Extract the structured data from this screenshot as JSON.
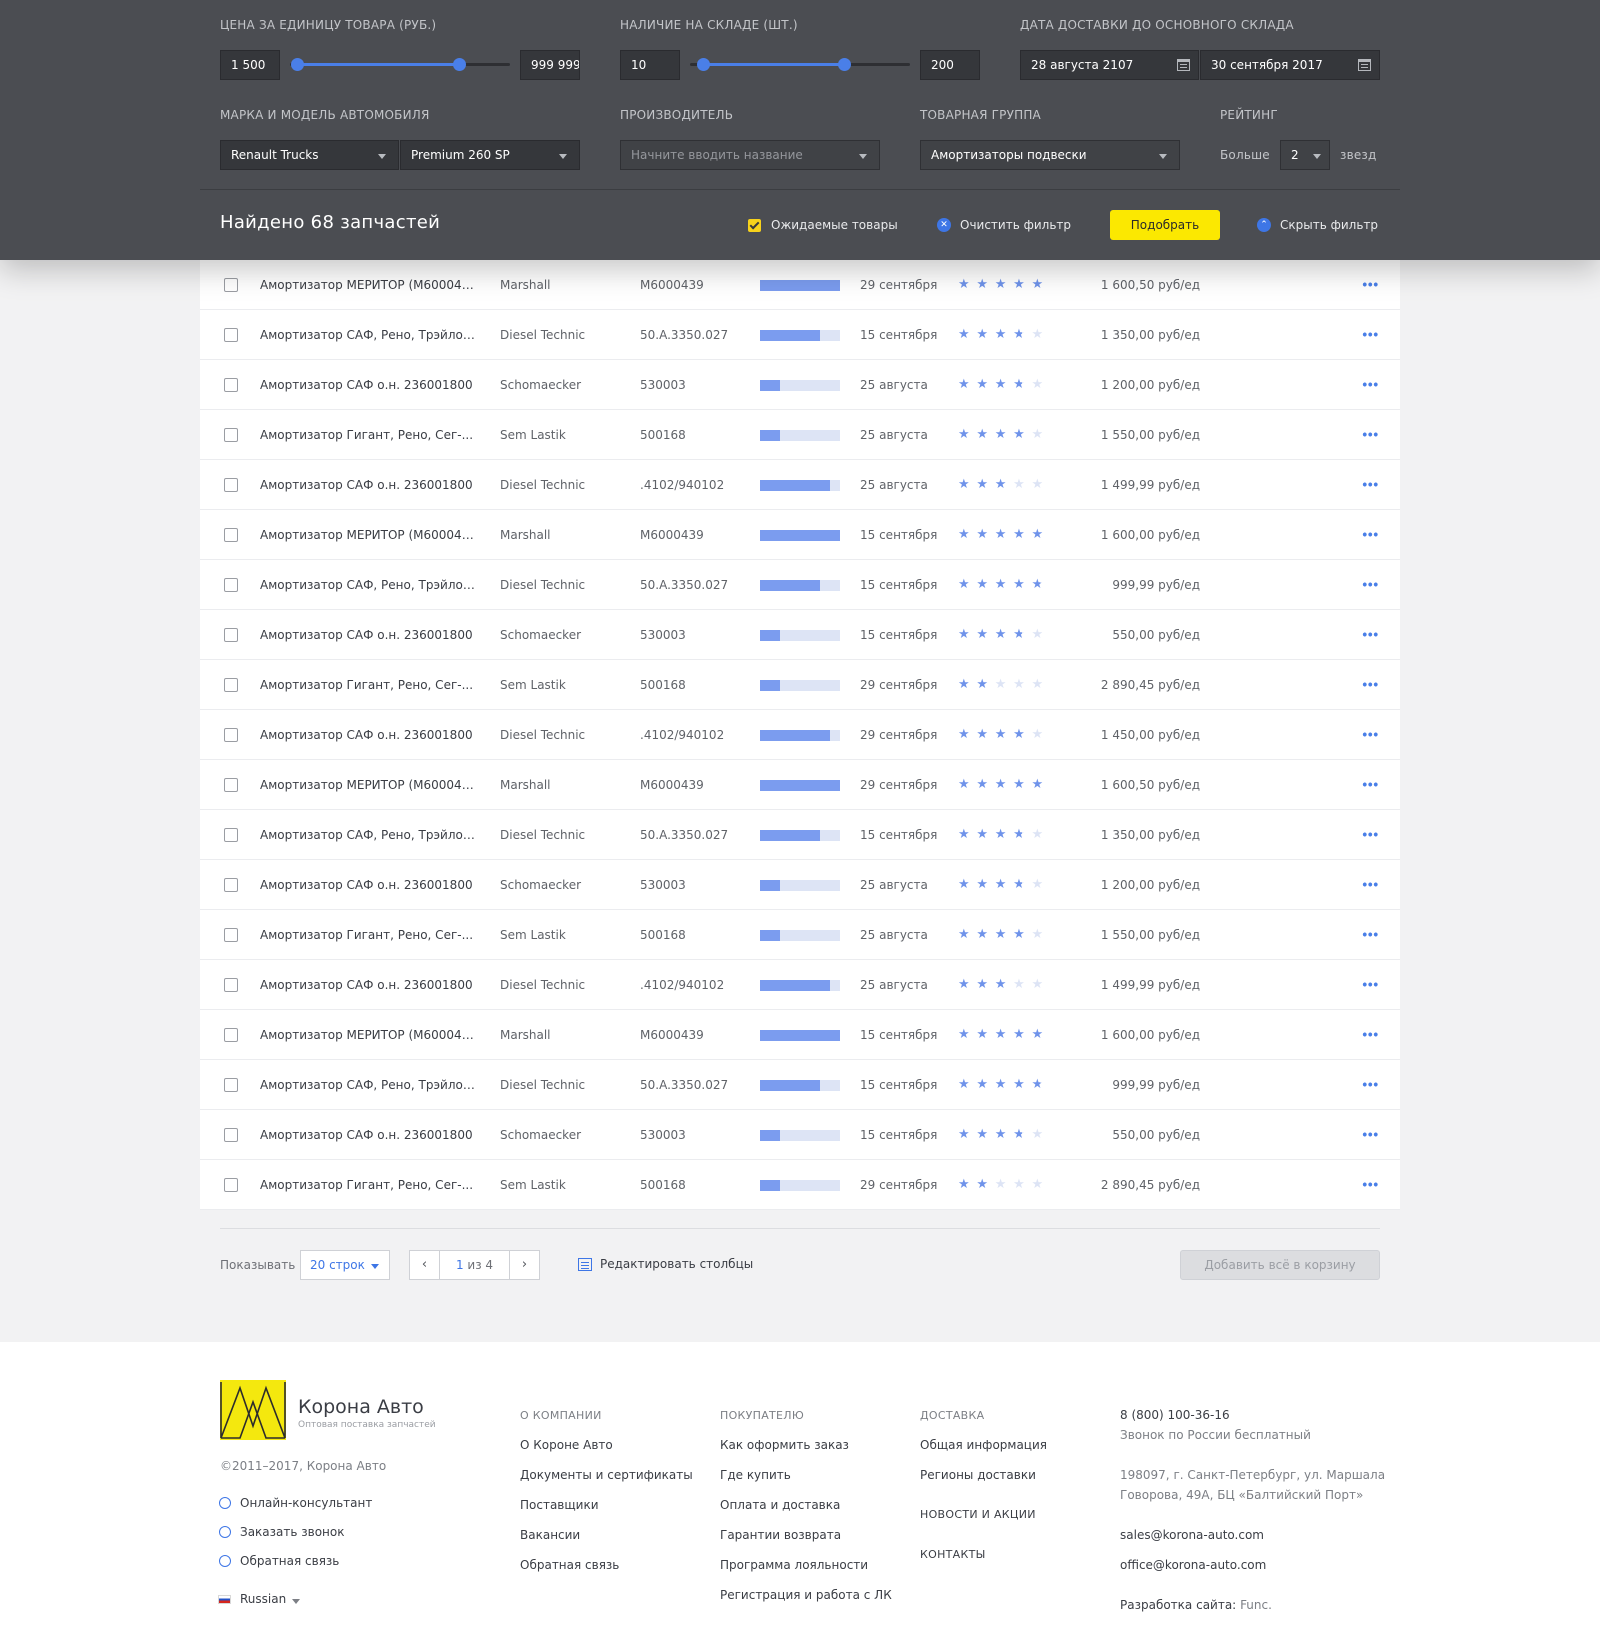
{
  "filters": {
    "price": {
      "label": "Цена за единицу товара (руб.)",
      "min": "1 500",
      "max": "999 999",
      "range_low": 0.03,
      "range_high": 0.77
    },
    "stock": {
      "label": "Наличие на складе (шт.)",
      "min": "10",
      "max": "200",
      "range_low": 0.06,
      "range_high": 0.7
    },
    "delivery_date": {
      "label": "Дата доставки до основного склада",
      "from": "28 августа 2107",
      "to": "30 сентября 2017"
    },
    "car_model": {
      "label": "Марка и модель автомобиля",
      "make": "Renault Trucks",
      "model": "Premium 260 SP"
    },
    "manufacturer": {
      "label": "Производитель",
      "placeholder": "Начните вводить название"
    },
    "product_group": {
      "label": "Товарная группа",
      "value": "Амортизаторы подвески"
    },
    "rating": {
      "label": "Рейтинг",
      "prefix": "Больше",
      "value": "2",
      "suffix": "звезд"
    }
  },
  "summary": {
    "found": "Найдено 68 запчастей",
    "expected_goods": "Ожидаемые товары",
    "clear_filter": "Очистить фильтр",
    "pick": "Подобрать",
    "hide_filter": "Скрыть фильтр"
  },
  "colors": {
    "accent": "#3e76e6",
    "stock_bar": "#7b9cef",
    "button_yellow": "#fbe801",
    "panel": "#4b4d52"
  },
  "rows": [
    {
      "name": "Амортизатор МЕРИТОР (M6000439)",
      "brand": "Marshall",
      "code": "M6000439",
      "stock": 1.0,
      "date": "29 сентября",
      "rating": 5,
      "price": "1 600,50 руб/ед"
    },
    {
      "name": "Амортизатор САФ, Рено, Трэйлор...",
      "brand": "Diesel Technic",
      "code": "50.A.3350.027",
      "stock": 0.75,
      "date": "15 сентября",
      "rating": 3.5,
      "price": "1 350,00 руб/ед"
    },
    {
      "name": "Амортизатор САФ о.н. 236001800",
      "brand": "Schomaecker",
      "code": "530003",
      "stock": 0.25,
      "date": "25 августа",
      "rating": 3.5,
      "price": "1 200,00 руб/ед"
    },
    {
      "name": "Амортизатор Гигант, Рено, Сег-...",
      "brand": "Sem Lastik",
      "code": "500168",
      "stock": 0.25,
      "date": "25 августа",
      "rating": 4,
      "price": "1 550,00 руб/ед"
    },
    {
      "name": "Амортизатор САФ о.н. 236001800",
      "brand": "Diesel Technic",
      "code": ".4102/940102",
      "stock": 0.88,
      "date": "25 августа",
      "rating": 3,
      "price": "1 499,99 руб/ед"
    },
    {
      "name": "Амортизатор МЕРИТОР (M6000439)",
      "brand": "Marshall",
      "code": "M6000439",
      "stock": 1.0,
      "date": "15 сентября",
      "rating": 5,
      "price": "1 600,00 руб/ед"
    },
    {
      "name": "Амортизатор САФ, Рено, Трэйлор...",
      "brand": "Diesel Technic",
      "code": "50.A.3350.027",
      "stock": 0.75,
      "date": "15 сентября",
      "rating": 4.5,
      "price": "999,99 руб/ед"
    },
    {
      "name": "Амортизатор САФ о.н. 236001800",
      "brand": "Schomaecker",
      "code": "530003",
      "stock": 0.25,
      "date": "15 сентября",
      "rating": 3.5,
      "price": "550,00 руб/ед"
    },
    {
      "name": "Амортизатор Гигант, Рено, Сег-...",
      "brand": "Sem Lastik",
      "code": "500168",
      "stock": 0.25,
      "date": "29 сентября",
      "rating": 2,
      "price": "2 890,45 руб/ед"
    },
    {
      "name": "Амортизатор САФ о.н. 236001800",
      "brand": "Diesel Technic",
      "code": ".4102/940102",
      "stock": 0.88,
      "date": "29 сентября",
      "rating": 4,
      "price": "1 450,00 руб/ед"
    },
    {
      "name": "Амортизатор МЕРИТОР (M6000439)",
      "brand": "Marshall",
      "code": "M6000439",
      "stock": 1.0,
      "date": "29 сентября",
      "rating": 5,
      "price": "1 600,50 руб/ед"
    },
    {
      "name": "Амортизатор САФ, Рено, Трэйлор...",
      "brand": "Diesel Technic",
      "code": "50.A.3350.027",
      "stock": 0.75,
      "date": "15 сентября",
      "rating": 3.5,
      "price": "1 350,00 руб/ед"
    },
    {
      "name": "Амортизатор САФ о.н. 236001800",
      "brand": "Schomaecker",
      "code": "530003",
      "stock": 0.25,
      "date": "25 августа",
      "rating": 3.5,
      "price": "1 200,00 руб/ед"
    },
    {
      "name": "Амортизатор Гигант, Рено, Сег-...",
      "brand": "Sem Lastik",
      "code": "500168",
      "stock": 0.25,
      "date": "25 августа",
      "rating": 4,
      "price": "1 550,00 руб/ед"
    },
    {
      "name": "Амортизатор САФ о.н. 236001800",
      "brand": "Diesel Technic",
      "code": ".4102/940102",
      "stock": 0.88,
      "date": "25 августа",
      "rating": 3,
      "price": "1 499,99 руб/ед"
    },
    {
      "name": "Амортизатор МЕРИТОР (M6000439)",
      "brand": "Marshall",
      "code": "M6000439",
      "stock": 1.0,
      "date": "15 сентября",
      "rating": 5,
      "price": "1 600,00 руб/ед"
    },
    {
      "name": "Амортизатор САФ, Рено, Трэйлор...",
      "brand": "Diesel Technic",
      "code": "50.A.3350.027",
      "stock": 0.75,
      "date": "15 сентября",
      "rating": 4.5,
      "price": "999,99 руб/ед"
    },
    {
      "name": "Амортизатор САФ о.н. 236001800",
      "brand": "Schomaecker",
      "code": "530003",
      "stock": 0.25,
      "date": "15 сентября",
      "rating": 3.5,
      "price": "550,00 руб/ед"
    },
    {
      "name": "Амортизатор Гигант, Рено, Сег-...",
      "brand": "Sem Lastik",
      "code": "500168",
      "stock": 0.25,
      "date": "29 сентября",
      "rating": 2,
      "price": "2 890,45 руб/ед"
    }
  ],
  "table_footer": {
    "show_label": "Показывать",
    "rows_per_page": "20 строк",
    "page_current": "1",
    "page_rest": "из 4",
    "edit_columns": "Редактировать столбцы",
    "add_all": "Добавить всё в корзину"
  },
  "footer": {
    "brand_name": "Корона Авто",
    "brand_tagline": "Оптовая поставка запчастей",
    "copyright": "©2011–2017, Корона Авто",
    "contact_links": [
      "Онлайн-консультант",
      "Заказать звонок",
      "Обратная связь"
    ],
    "language": "Russian",
    "columns": [
      {
        "title": "О компании",
        "items": [
          "О Короне Авто",
          "Документы и сертификаты",
          "Поставщики",
          "Вакансии",
          "Обратная связь"
        ]
      },
      {
        "title": "Покупателю",
        "items": [
          "Как оформить заказ",
          "Где купить",
          "Оплата и доставка",
          "Гарантии возврата",
          "Программа лояльности",
          "Регистрация и работа с ЛК"
        ]
      },
      {
        "title": "Доставка",
        "items": [
          "Общая информация",
          "Регионы доставки"
        ]
      }
    ],
    "news": "Новости и акции",
    "contacts": "Контакты",
    "phone": "8 (800) 100-36-16",
    "phone_note": "Звонок по России бесплатный",
    "address_line1": "198097, г. Санкт-Петербург, ул. Маршала",
    "address_line2": "Говорова, 49А, БЦ «Балтийский Порт»",
    "email_sales": "sales@korona-auto.com",
    "email_office": "office@korona-auto.com",
    "dev_label": "Разработка сайта:",
    "dev_name": "Func."
  }
}
